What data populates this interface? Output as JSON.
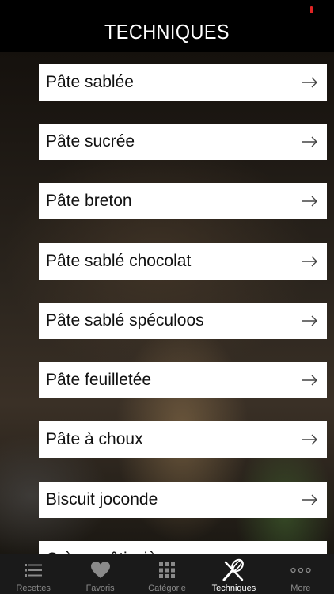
{
  "header": {
    "title": "TECHNIQUES"
  },
  "techniques": [
    {
      "label": "Pâte sablée",
      "icon": "arrow-right-icon"
    },
    {
      "label": "Pâte sucrée",
      "icon": "arrow-right-icon"
    },
    {
      "label": "Pâte breton",
      "icon": "arrow-right-icon"
    },
    {
      "label": "Pâte sablé chocolat",
      "icon": "arrow-right-icon"
    },
    {
      "label": "Pâte sablé spéculoos",
      "icon": "arrow-right-icon"
    },
    {
      "label": "Pâte feuilletée",
      "icon": "arrow-right-icon"
    },
    {
      "label": "Pâte à choux",
      "icon": "arrow-right-icon"
    },
    {
      "label": "Biscuit joconde",
      "icon": "arrow-right-icon"
    },
    {
      "label": "Crème pâtissière",
      "icon": "arrow-right-icon"
    }
  ],
  "tabbar": {
    "tabs": [
      {
        "label": "Recettes",
        "icon": "list-icon",
        "active": false
      },
      {
        "label": "Favoris",
        "icon": "heart-icon",
        "active": false
      },
      {
        "label": "Catégorie",
        "icon": "grid-icon",
        "active": false
      },
      {
        "label": "Techniques",
        "icon": "whisk-icon",
        "active": true
      },
      {
        "label": "More",
        "icon": "more-icon",
        "active": false
      }
    ]
  },
  "colors": {
    "header_bg": "#000000",
    "tabbar_bg": "#1a1a1a",
    "tab_active": "#ffffff",
    "tab_inactive": "#8a8a8a",
    "status_indicator": "#e02424"
  }
}
